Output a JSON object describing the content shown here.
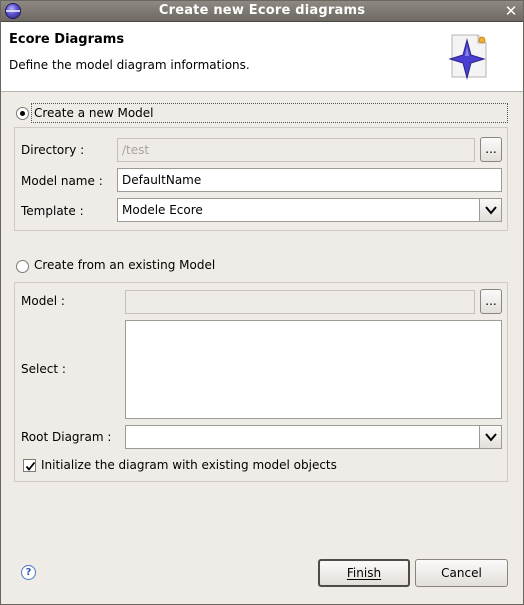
{
  "window": {
    "title": "Create new Ecore diagrams"
  },
  "header": {
    "title": "Ecore Diagrams",
    "description": "Define the model diagram informations.",
    "icon": "ecore-diagram-icon"
  },
  "new_model": {
    "radio_label": "Create a new Model",
    "selected": true,
    "directory_label": "Directory :",
    "directory_value": "/test",
    "browse_label": "...",
    "model_name_label": "Model name :",
    "model_name_value": "DefaultName",
    "template_label": "Template :",
    "template_value": "Modele Ecore"
  },
  "existing_model": {
    "radio_label": "Create from an existing Model",
    "selected": false,
    "model_label": "Model :",
    "model_value": "",
    "browse_label": "...",
    "select_label": "Select :",
    "root_diagram_label": "Root Diagram :",
    "root_diagram_value": "",
    "init_checkbox_label": "Initialize the diagram with existing model objects",
    "init_checked": true
  },
  "footer": {
    "finish_label": "Finish",
    "cancel_label": "Cancel",
    "help_icon": "help-icon",
    "help_glyph": "?"
  },
  "colors": {
    "window_background": "#efebe7",
    "titlebar": "#7a756f",
    "icon_star": "#4a3fd0"
  }
}
